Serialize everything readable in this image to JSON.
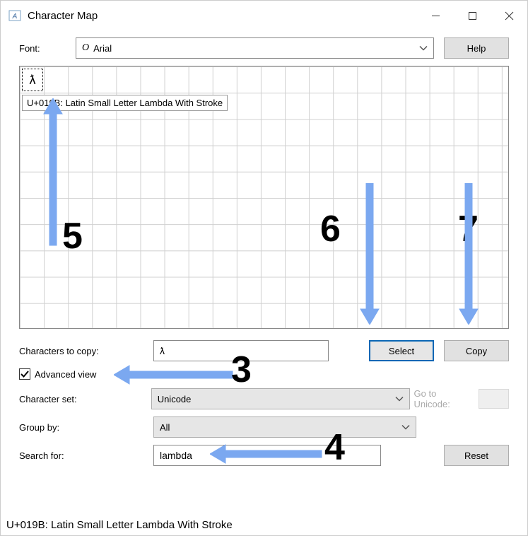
{
  "title": "Character Map",
  "font_label": "Font:",
  "font_value": "Arial",
  "help_label": "Help",
  "selected_char": "ƛ",
  "tooltip": "U+019B: Latin Small Letter Lambda With Stroke",
  "chars_to_copy_label": "Characters to copy:",
  "chars_to_copy_value": "ƛ",
  "select_label": "Select",
  "copy_label": "Copy",
  "advanced_view_label": "Advanced view",
  "advanced_view_checked": true,
  "charset_label": "Character set:",
  "charset_value": "Unicode",
  "goto_unicode_label": "Go to Unicode:",
  "groupby_label": "Group by:",
  "groupby_value": "All",
  "search_label": "Search for:",
  "search_value": "lambda",
  "reset_label": "Reset",
  "status": "U+019B: Latin Small Letter Lambda With Stroke",
  "annotations": {
    "n3": "3",
    "n4": "4",
    "n5": "5",
    "n6": "6",
    "n7": "7"
  }
}
